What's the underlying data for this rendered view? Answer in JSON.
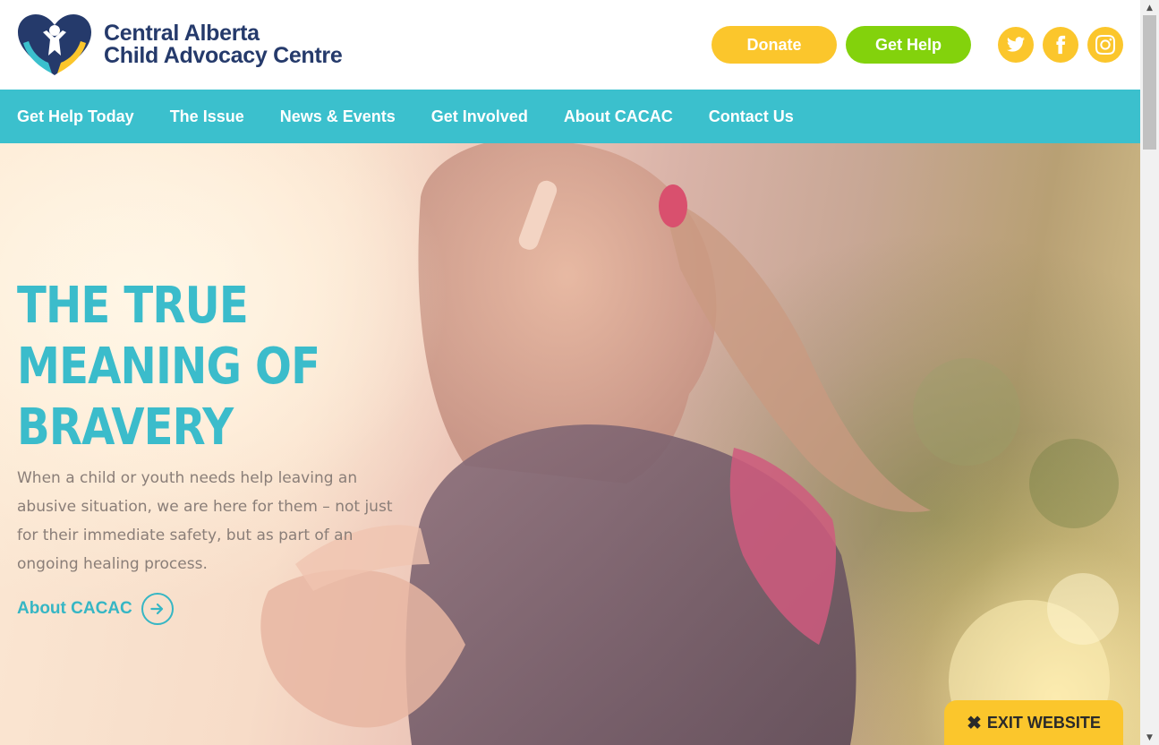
{
  "logo": {
    "line1": "Central Alberta",
    "line2": "Child Advocacy Centre",
    "icon": "heart-hands-child-logo"
  },
  "header": {
    "donate_label": "Donate",
    "get_help_label": "Get Help",
    "social": [
      "twitter-icon",
      "facebook-icon",
      "instagram-icon"
    ]
  },
  "nav": {
    "items": [
      {
        "label": "Get Help Today"
      },
      {
        "label": "The Issue"
      },
      {
        "label": "News & Events"
      },
      {
        "label": "Get Involved"
      },
      {
        "label": "About CACAC"
      },
      {
        "label": "Contact Us"
      }
    ]
  },
  "hero": {
    "title_lines": [
      "The True",
      "Meaning of",
      "Bravery"
    ],
    "body": "When a child or youth needs help leaving an abusive situation, we are here for them – not just for their immediate safety, but as part of an ongoing healing process.",
    "link_label": "About CACAC"
  },
  "exit": {
    "label": "EXIT WEBSITE"
  },
  "colors": {
    "teal": "#3bc0cd",
    "yellow": "#fbc62c",
    "green": "#83d20c",
    "navy": "#253a6b"
  }
}
